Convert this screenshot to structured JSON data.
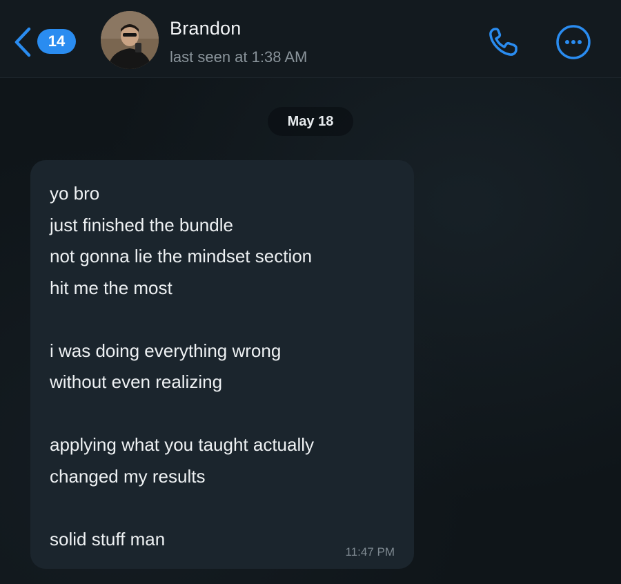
{
  "header": {
    "back_badge_count": "14",
    "contact_name": "Brandon",
    "contact_status": "last seen at 1:38 AM",
    "accent_color": "#2a8cf0",
    "icons": [
      "back-chevron-icon",
      "phone-icon",
      "more-options-icon"
    ]
  },
  "chat": {
    "date_separator": "May 18",
    "message": {
      "lines": [
        "yo bro",
        "just finished the bundle",
        "not gonna lie the mindset section",
        "hit me the most",
        "",
        "i was doing everything wrong",
        "without even realizing",
        "",
        "applying what you taught actually",
        "changed my results",
        "",
        "solid stuff man"
      ],
      "time": "11:47 PM",
      "bubble_color": "#1b252d"
    }
  }
}
